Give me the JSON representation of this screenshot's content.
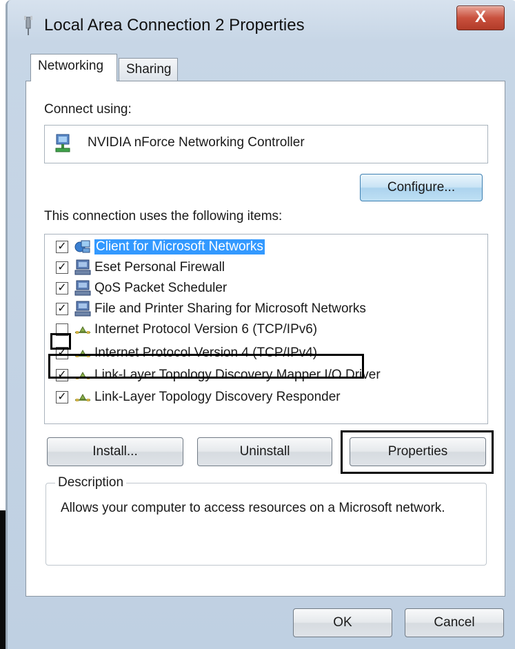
{
  "window": {
    "title": "Local Area Connection 2 Properties",
    "close_label": "X"
  },
  "tabs": [
    {
      "label": "Networking",
      "active": true
    },
    {
      "label": "Sharing",
      "active": false
    }
  ],
  "connect": {
    "label": "Connect using:",
    "adapter": "NVIDIA nForce Networking Controller",
    "configure_label": "Configure..."
  },
  "items_section": {
    "label": "This connection uses the following items:",
    "items": [
      {
        "label": "Client for Microsoft Networks",
        "checked": true,
        "icon": "network-client-icon",
        "selected": true
      },
      {
        "label": "Eset Personal Firewall",
        "checked": true,
        "icon": "computer-icon",
        "selected": false
      },
      {
        "label": "QoS Packet Scheduler",
        "checked": true,
        "icon": "computer-icon",
        "selected": false
      },
      {
        "label": "File and Printer Sharing for Microsoft Networks",
        "checked": true,
        "icon": "computer-icon",
        "selected": false
      },
      {
        "label": "Internet Protocol Version 6 (TCP/IPv6)",
        "checked": false,
        "icon": "protocol-icon",
        "selected": false
      },
      {
        "label": "Internet Protocol Version 4 (TCP/IPv4)",
        "checked": true,
        "icon": "protocol-icon",
        "selected": false
      },
      {
        "label": "Link-Layer Topology Discovery Mapper I/O Driver",
        "checked": true,
        "icon": "protocol-icon",
        "selected": false
      },
      {
        "label": "Link-Layer Topology Discovery Responder",
        "checked": true,
        "icon": "protocol-icon",
        "selected": false
      }
    ]
  },
  "buttons": {
    "install": "Install...",
    "uninstall": "Uninstall",
    "properties": "Properties",
    "ok": "OK",
    "cancel": "Cancel"
  },
  "description": {
    "legend": "Description",
    "text": "Allows your computer to access resources on a Microsoft network."
  },
  "colors": {
    "selection": "#3399ff",
    "close_button": "#c9513e",
    "highlight_outline": "#000000"
  }
}
